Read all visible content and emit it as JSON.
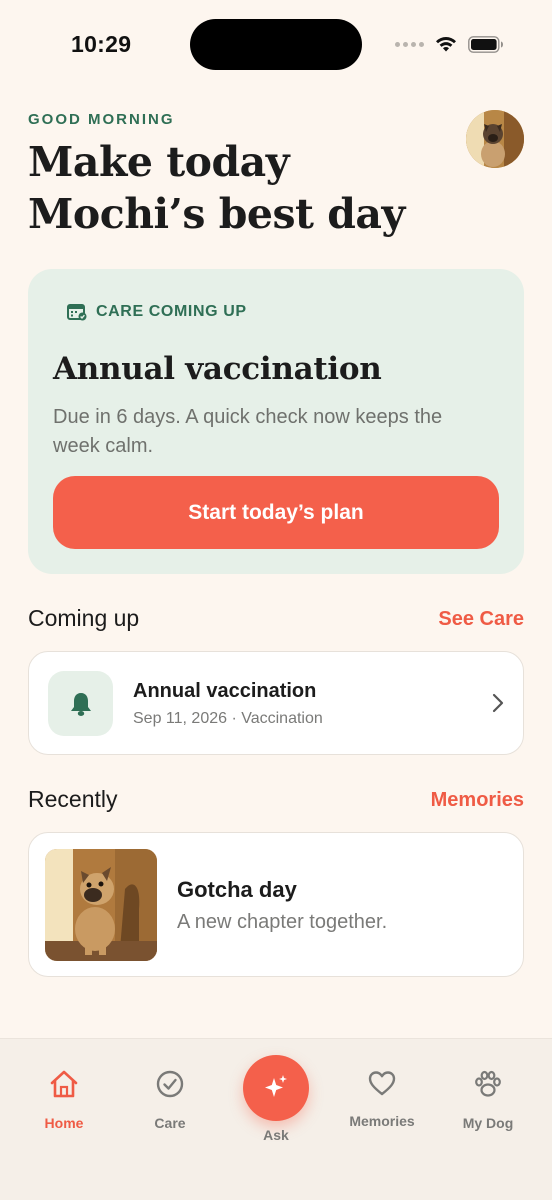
{
  "status_bar": {
    "time": "10:29"
  },
  "header": {
    "greeting": "GOOD MORNING",
    "headline": "Make today Mochi’s best day"
  },
  "care_card": {
    "tag": "CARE COMING UP",
    "title": "Annual vaccination",
    "description": "Due in 6 days. A quick check now keeps the week calm.",
    "button_label": "Start today’s plan"
  },
  "coming_up": {
    "title": "Coming up",
    "link": "See Care",
    "items": [
      {
        "title": "Annual vaccination",
        "subtitle": "Sep 11, 2026 · Vaccination",
        "icon": "bell-icon"
      }
    ]
  },
  "recently": {
    "title": "Recently",
    "link": "Memories",
    "items": [
      {
        "title": "Gotcha day",
        "subtitle": "A new chapter together."
      }
    ]
  },
  "tab_bar": {
    "tabs": [
      {
        "label": "Home",
        "icon": "home-icon",
        "active": true
      },
      {
        "label": "Care",
        "icon": "check-circle-icon",
        "active": false
      },
      {
        "label": "Ask",
        "icon": "sparkle-icon",
        "active": false
      },
      {
        "label": "Memories",
        "icon": "heart-icon",
        "active": false
      },
      {
        "label": "My Dog",
        "icon": "paw-icon",
        "active": false
      }
    ]
  },
  "colors": {
    "background": "#fdf6ef",
    "accent": "#f4604b",
    "green": "#2f6f55",
    "card_green": "#e6f0e8"
  }
}
